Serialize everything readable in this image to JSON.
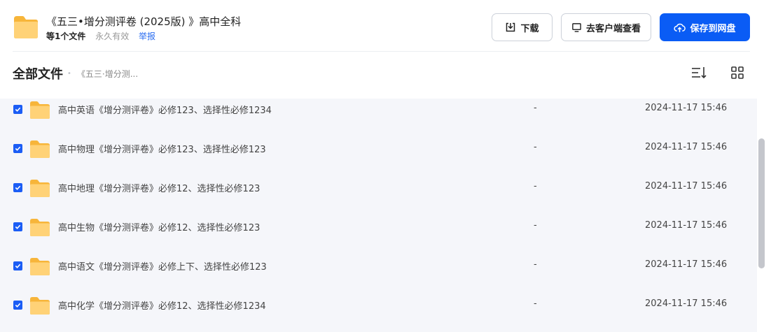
{
  "header": {
    "title": "《五三•增分测评卷 (2025版) 》高中全科",
    "file_count": "等1个文件",
    "validity": "永久有效",
    "report": "举报",
    "folder_icon": "folder-icon"
  },
  "actions": {
    "download": "下载",
    "open_client": "去客户端查看",
    "save": "保存到网盘",
    "download_icon": "download-icon",
    "client_icon": "monitor-icon",
    "save_icon": "cloud-upload-icon",
    "accent_color": "#0a5cf5"
  },
  "breadcrumb": {
    "root": "全部文件",
    "current": "《五三·增分测..."
  },
  "toolbar": {
    "sort_icon": "sort-icon",
    "grid_icon": "grid-view-icon"
  },
  "files": [
    {
      "name": "高中英语《增分测评卷》必修123、选择性必修1234",
      "size": "-",
      "date": "2024-11-17 15:46",
      "checked": true
    },
    {
      "name": "高中物理《增分测评卷》必修123、选择性必修123",
      "size": "-",
      "date": "2024-11-17 15:46",
      "checked": true
    },
    {
      "name": "高中地理《增分测评卷》必修12、选择性必修123",
      "size": "-",
      "date": "2024-11-17 15:46",
      "checked": true
    },
    {
      "name": "高中生物《增分测评卷》必修12、选择性必修123",
      "size": "-",
      "date": "2024-11-17 15:46",
      "checked": true
    },
    {
      "name": "高中语文《增分测评卷》必修上下、选择性必修123",
      "size": "-",
      "date": "2024-11-17 15:46",
      "checked": true
    },
    {
      "name": "高中化学《增分测评卷》必修12、选择性必修1234",
      "size": "-",
      "date": "2024-11-17 15:46",
      "checked": true
    }
  ]
}
